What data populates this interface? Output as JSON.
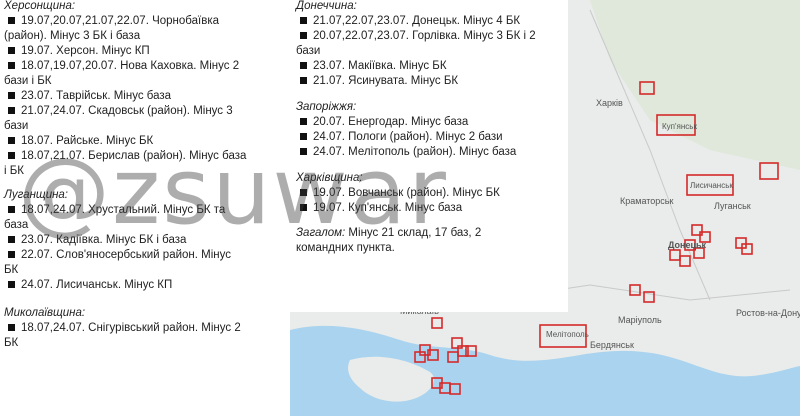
{
  "watermark": "@zsuwar",
  "left_column": [
    {
      "title": "Херсонщина:",
      "items": [
        "19.07,20.07,21.07,22.07. Чорнобаївка",
        "(район). Мінус 3 БК і база",
        "19.07. Херсон. Мінус КП",
        "18.07,19.07,20.07. Нова Каховка. Мінус 2",
        "бази і БК",
        "23.07. Таврійськ. Мінус база",
        "21.07,24.07. Скадовськ (район). Мінус 3",
        "бази",
        "18.07. Райське. Мінус БК",
        "18.07,21.07. Берислав (район). Мінус база",
        "і БК"
      ],
      "bullets": [
        true,
        false,
        true,
        true,
        false,
        true,
        true,
        false,
        true,
        true,
        false
      ]
    },
    {
      "title": "Луганщина:",
      "items": [
        "18.07,24.07. Хрустальний. Мінус БК та",
        "база",
        "23.07. Кадіївка. Мінус БК і база",
        "22.07. Слов'яносербський район. Мінус",
        "БК",
        "24.07. Лисичанськ. Мінус КП"
      ],
      "bullets": [
        true,
        false,
        true,
        true,
        false,
        true
      ]
    },
    {
      "title": "Миколаївщина:",
      "items": [
        "18.07,24.07. Снігурівський район. Мінус 2",
        "БК"
      ],
      "bullets": [
        true,
        false
      ]
    }
  ],
  "right_column": [
    {
      "title": "Донеччина:",
      "items": [
        "21.07,22.07,23.07. Донецьк. Мінус 4 БК",
        "20.07,22.07,23.07. Горлівка. Мінус 3 БК і 2",
        "бази",
        "23.07. Макіївка. Мінус БК",
        "21.07. Ясинувата. Мінус БК"
      ],
      "bullets": [
        true,
        true,
        false,
        true,
        true
      ]
    },
    {
      "title": "Запоріжжя:",
      "items": [
        "20.07. Енергодар. Мінус база",
        "24.07. Пологи (район). Мінус 2 бази",
        "24.07. Мелітополь (район). Мінус база"
      ],
      "bullets": [
        true,
        true,
        true
      ]
    },
    {
      "title": "Харківщина:",
      "items": [
        "19.07. Вовчанськ (район). Мінус БК",
        "19.07. Куп'янськ. Мінус база"
      ],
      "bullets": [
        true,
        true
      ]
    }
  ],
  "summary": {
    "label": "Загалом:",
    "line1": " Мінус 21 склад, 17 баз, 2",
    "line2": "командних пункта."
  },
  "map_labels": {
    "kharkiv": "Харків",
    "kupiansk": "Куп'янськ",
    "lysychansk": "Лисичанськ",
    "kramatorsk": "Краматорськ",
    "luhansk": "Луганськ",
    "donetsk": "Донецьк",
    "mariupol": "Маріуполь",
    "rostov": "Ростов-на-Дону",
    "mykolaiv": "Миколаїв",
    "melitopol": "Мелітополь",
    "berdiansk": "Бердянськ"
  },
  "colors": {
    "map_land": "#e9ecea",
    "map_green": "#d8e8d2",
    "sea": "#a9d3ef",
    "marker": "#d42a2a"
  }
}
